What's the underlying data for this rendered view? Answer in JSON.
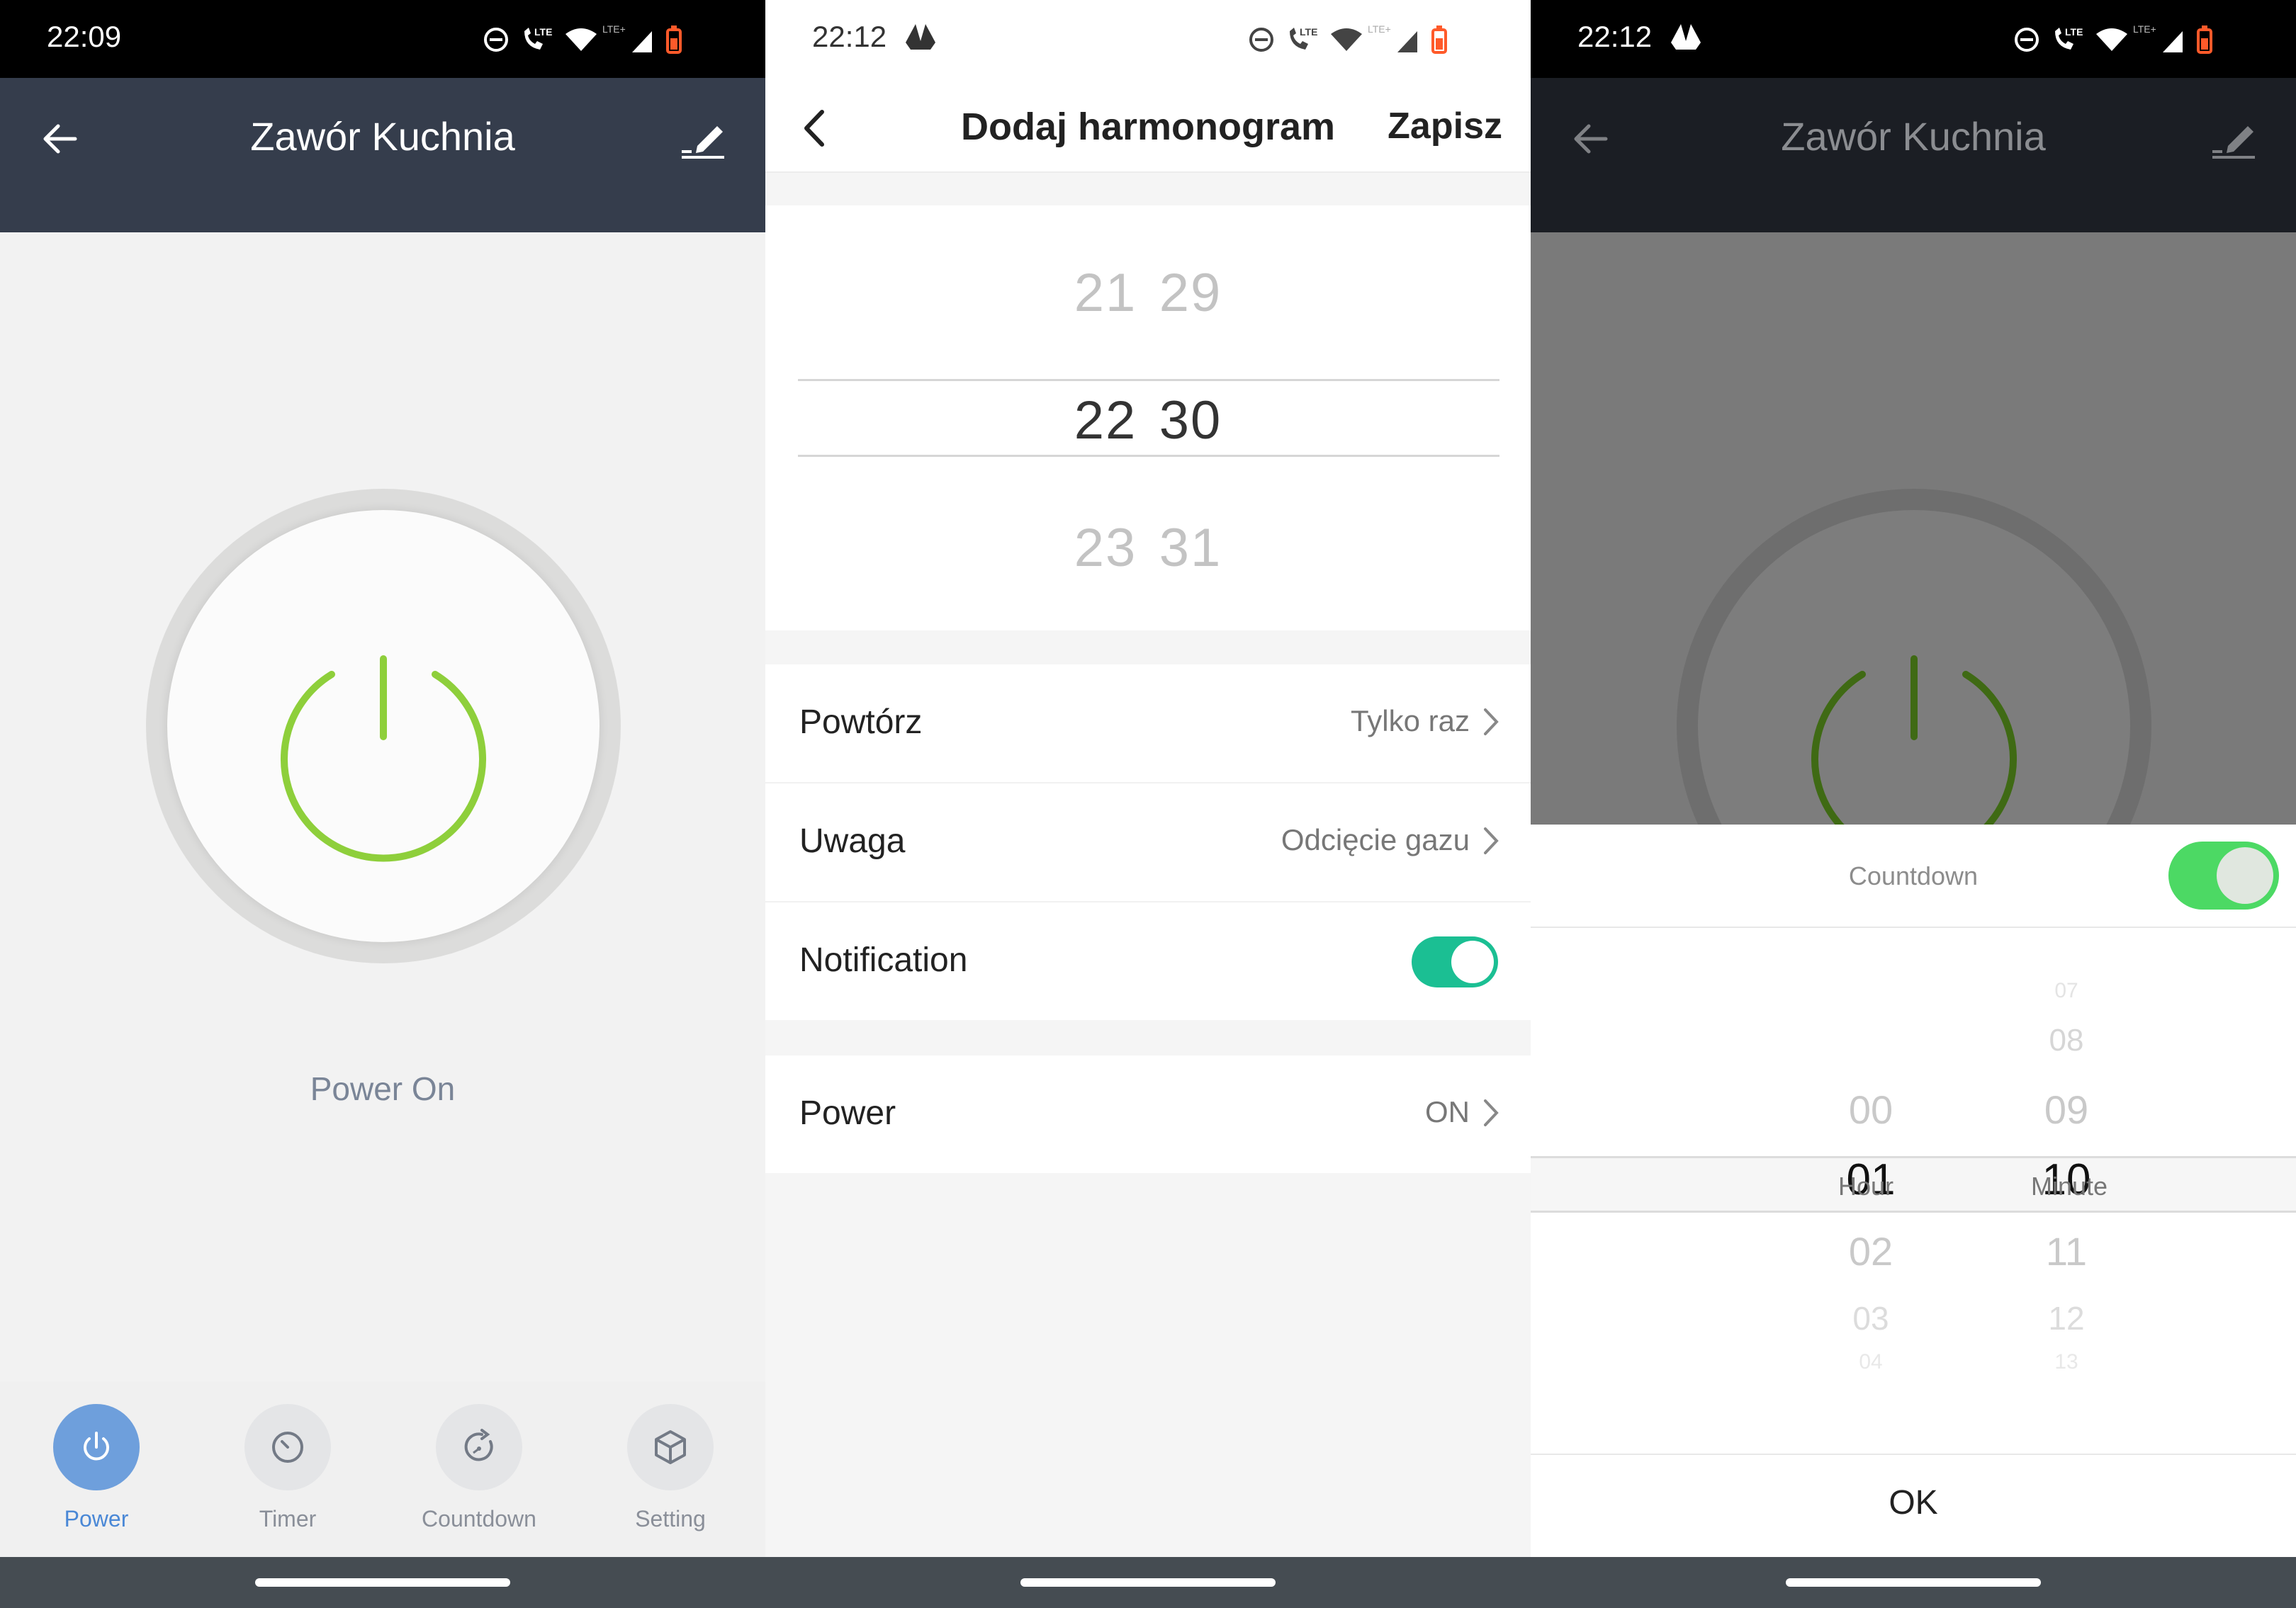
{
  "panel1": {
    "status_time": "22:09",
    "title": "Zawór Kuchnia",
    "power_label": "Power On",
    "accent_color": "#8ecf3b",
    "tabs": [
      {
        "label": "Power",
        "icon": "power-icon",
        "active": true
      },
      {
        "label": "Timer",
        "icon": "timer-icon",
        "active": false
      },
      {
        "label": "Countdown",
        "icon": "countdown-icon",
        "active": false
      },
      {
        "label": "Setting",
        "icon": "cube-icon",
        "active": false
      }
    ]
  },
  "panel2": {
    "status_time": "22:12",
    "title": "Dodaj harmonogram",
    "save_label": "Zapisz",
    "picker": {
      "above": {
        "hour": "21",
        "minute": "29"
      },
      "selected": {
        "hour": "22",
        "minute": "30"
      },
      "below": {
        "hour": "23",
        "minute": "31"
      }
    },
    "rows": {
      "repeat": {
        "label": "Powtórz",
        "value": "Tylko raz"
      },
      "note": {
        "label": "Uwaga",
        "value": "Odcięcie gazu"
      },
      "notification": {
        "label": "Notification",
        "on": true
      },
      "power": {
        "label": "Power",
        "value": "ON"
      }
    },
    "toggle_color": "#1bbf93"
  },
  "panel3": {
    "status_time": "22:12",
    "title": "Zawór Kuchnia",
    "countdown_label": "Countdown",
    "toggle_on": true,
    "hours": [
      "00",
      "01",
      "02",
      "03",
      "04"
    ],
    "minutes": [
      "07",
      "08",
      "09",
      "10",
      "11",
      "12",
      "13"
    ],
    "hour_unit": "Hour",
    "minute_unit": "Minute",
    "selected_hour": "01",
    "selected_minute": "10",
    "ok_label": "OK"
  }
}
